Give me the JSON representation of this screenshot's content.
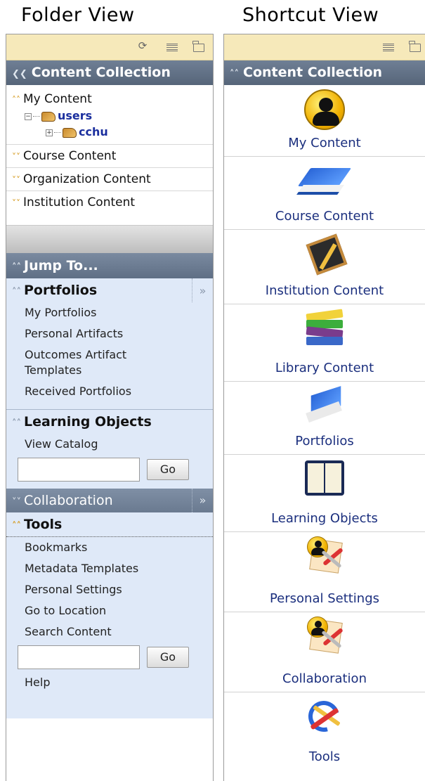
{
  "folder_view": {
    "title": "Folder View",
    "toolbar": {
      "icons": [
        "refresh-icon",
        "list-view-icon",
        "folder-view-icon"
      ],
      "refresh_glyph": "⟳"
    },
    "content_collection": {
      "header": "Content Collection",
      "items": {
        "my_content": "My Content",
        "users": "users",
        "cchu": "cchu",
        "course_content": "Course Content",
        "organization_content": "Organization Content",
        "institution_content": "Institution Content"
      }
    },
    "jump_to": {
      "header": "Jump To...",
      "portfolios": {
        "header": "Portfolios",
        "links": [
          "My Portfolios",
          "Personal Artifacts",
          "Outcomes Artifact Templates",
          "Received Portfolios"
        ]
      },
      "learning_objects": {
        "header": "Learning Objects",
        "links": [
          "View Catalog"
        ],
        "go_label": "Go",
        "input_value": ""
      },
      "collaboration": {
        "header": "Collaboration"
      },
      "tools": {
        "header": "Tools",
        "links": [
          "Bookmarks",
          "Metadata Templates",
          "Personal Settings",
          "Go to Location",
          "Search Content"
        ],
        "go_label": "Go",
        "input_value": "",
        "help": "Help"
      }
    }
  },
  "shortcut_view": {
    "title": "Shortcut View",
    "toolbar": {
      "icons": [
        "list-view-icon",
        "folder-view-icon"
      ]
    },
    "header": "Content Collection",
    "items": [
      {
        "label": "My Content",
        "icon": "user-avatar-icon"
      },
      {
        "label": "Course Content",
        "icon": "blue-book-icon"
      },
      {
        "label": "Institution Content",
        "icon": "chalkboard-icon"
      },
      {
        "label": "Library Content",
        "icon": "book-stack-icon"
      },
      {
        "label": "Portfolios",
        "icon": "portfolio-book-icon"
      },
      {
        "label": "Learning Objects",
        "icon": "open-book-icon"
      },
      {
        "label": "Personal Settings",
        "icon": "user-settings-icon"
      },
      {
        "label": "Collaboration",
        "icon": "collaboration-icon"
      },
      {
        "label": "Tools",
        "icon": "tools-icon"
      }
    ]
  },
  "colors": {
    "header_bar": "#5c6b80",
    "toolbar_bg": "#f6e9ba",
    "jump_bg": "#dfe9f8",
    "link_blue": "#1b2f7e",
    "chevron_gold": "#d59a1e"
  }
}
